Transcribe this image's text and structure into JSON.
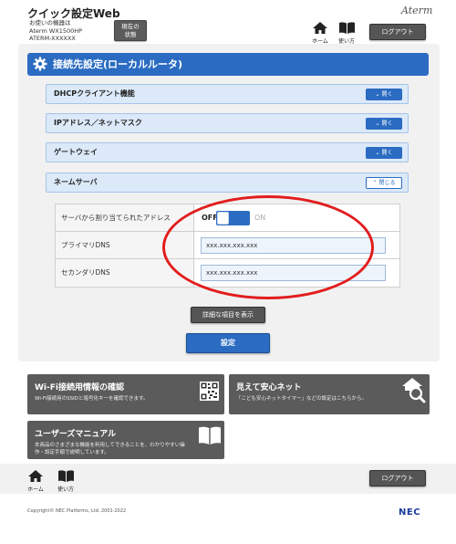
{
  "header": {
    "title": "クイック設定Web",
    "device_lines": [
      "お使いの機器は",
      "Aterm WX1500HP",
      "ATERM-XXXXXX"
    ],
    "status_button": [
      "現在の",
      "状態"
    ],
    "brand": "Aterm",
    "home_label": "ホーム",
    "help_label": "使い方",
    "logout_label": "ログアウト"
  },
  "section": {
    "title": "接続先設定(ローカルルータ)",
    "icon": "gear-icon"
  },
  "accordion": [
    {
      "label": "DHCPクライアント機能",
      "button": "開く",
      "expanded": false
    },
    {
      "label": "IPアドレス／ネットマスク",
      "button": "開く",
      "expanded": false
    },
    {
      "label": "ゲートウェイ",
      "button": "開く",
      "expanded": false
    },
    {
      "label": "ネームサーバ",
      "button": "閉じる",
      "expanded": true
    }
  ],
  "name_server": {
    "auto_label": "サーバから割り当てられたアドレス",
    "toggle_off": "OFF",
    "toggle_on": "ON",
    "toggle_state": "off",
    "primary_label": "プライマリDNS",
    "primary_value": "xxx.xxx.xxx.xxx",
    "secondary_label": "セカンダリDNS",
    "secondary_value": "xxx.xxx.xxx.xxx"
  },
  "actions": {
    "detail_label": "詳細な項目を表示",
    "apply_label": "設定"
  },
  "cards": {
    "wifi": {
      "title": "Wi-Fi接続用情報の確認",
      "desc": "Wi-Fi接続用のSSIDと暗号化キーを確認できます。",
      "icon": "qr-code-icon"
    },
    "safety": {
      "title": "見えて安心ネット",
      "desc": "「こども安心ネットタイマー」などの設定はこちらから。",
      "icon": "house-search-icon"
    },
    "manual": {
      "title": "ユーザーズマニュアル",
      "desc_lines": [
        "本商品のさまざまな機能を利用してできることを、わかりやすい操",
        "作・設定手順で説明しています。"
      ],
      "icon": "book-icon"
    }
  },
  "footer": {
    "home_label": "ホーム",
    "help_label": "使い方",
    "logout_label": "ログアウト",
    "copyright": "Copyright© NEC Platforms, Ltd. 2001-2022",
    "logo": "NEC"
  },
  "colors": {
    "accent": "#2b6cc2",
    "accordion_bg": "#dbe9f8",
    "dark_button": "#555555",
    "annotation": "#e21d1d"
  }
}
